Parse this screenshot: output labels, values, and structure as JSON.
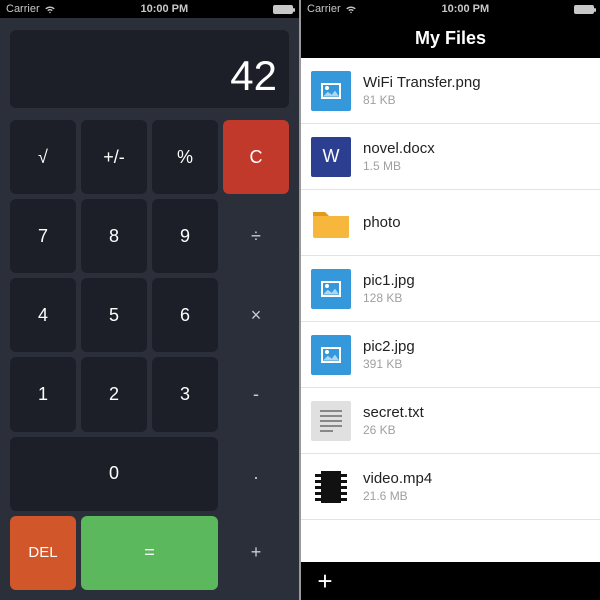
{
  "statusbar": {
    "carrier": "Carrier",
    "time": "10:00 PM"
  },
  "calculator": {
    "display": "42",
    "keys": {
      "sqrt": "√",
      "plusminus": "+/-",
      "percent": "%",
      "clear": "C",
      "divide": "÷",
      "multiply": "×",
      "minus": "-",
      "plus": "+",
      "del": "DEL",
      "equals": "=",
      "dot": ".",
      "n0": "0",
      "n1": "1",
      "n2": "2",
      "n3": "3",
      "n4": "4",
      "n5": "5",
      "n6": "6",
      "n7": "7",
      "n8": "8",
      "n9": "9"
    }
  },
  "files": {
    "title": "My Files",
    "add": "+",
    "items": [
      {
        "name": "WiFi Transfer.png",
        "size": "81 KB",
        "type": "image"
      },
      {
        "name": "novel.docx",
        "size": "1.5 MB",
        "type": "doc",
        "letter": "W"
      },
      {
        "name": "photo",
        "size": "",
        "type": "folder"
      },
      {
        "name": "pic1.jpg",
        "size": "128 KB",
        "type": "image"
      },
      {
        "name": "pic2.jpg",
        "size": "391 KB",
        "type": "image"
      },
      {
        "name": "secret.txt",
        "size": "26 KB",
        "type": "txt"
      },
      {
        "name": "video.mp4",
        "size": "21.6 MB",
        "type": "video"
      }
    ]
  }
}
